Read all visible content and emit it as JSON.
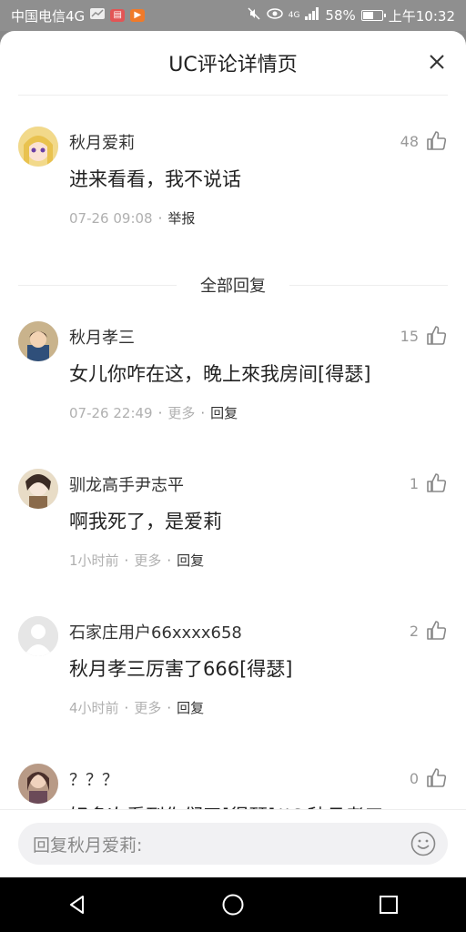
{
  "status_bar": {
    "carrier": "中国电信4G",
    "signal_label": "4G",
    "battery": "58%",
    "battery_level": 0.58,
    "time": "上午10:32"
  },
  "header": {
    "title": "UC评论详情页",
    "close_icon": "close-icon"
  },
  "main_comment": {
    "user": "秋月爱莉",
    "text": "进来看看，我不说话",
    "time": "07-26 09:08",
    "report_label": "举报",
    "likes": "48"
  },
  "section": {
    "label": "全部回复"
  },
  "replies": [
    {
      "user": "秋月孝三",
      "text": "女儿你咋在这，晚上來我房间[得瑟]",
      "time": "07-26 22:49",
      "more": "更多",
      "reply": "回复",
      "likes": "15"
    },
    {
      "user": "驯龙高手尹志平",
      "text": "啊我死了，是爱莉",
      "time": "1小时前",
      "more": "更多",
      "reply": "回复",
      "likes": "1"
    },
    {
      "user": "石家庄用户66xxxx658",
      "text": "秋月孝三厉害了666[得瑟]",
      "time": "4小时前",
      "more": "更多",
      "reply": "回复",
      "likes": "2"
    },
    {
      "user": "？？？",
      "text": "好多次看到你们了[得瑟]//@秋月孝三",
      "likes": "0"
    }
  ],
  "reply_bar": {
    "placeholder": "回复秋月爱莉:"
  },
  "colors": {
    "accent_text": "#222222",
    "meta_grey": "#b0b0b0",
    "overlay": "#888888"
  }
}
